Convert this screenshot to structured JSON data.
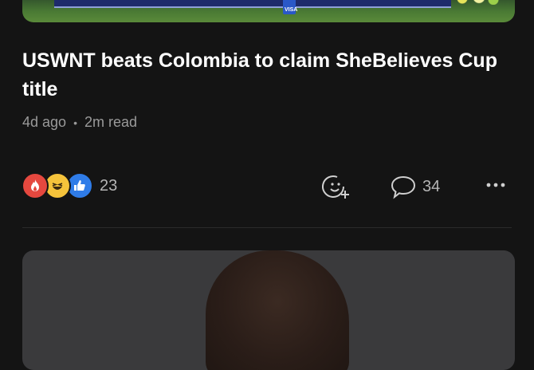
{
  "article": {
    "title": "USWNT beats Colombia to claim SheBelieves Cup title",
    "age": "4d ago",
    "separator": "•",
    "read_time": "2m read",
    "top_image_caption": "VISA"
  },
  "engagement": {
    "reaction_icons": [
      "fire-reaction-icon",
      "laugh-reaction-icon",
      "thumbs-up-reaction-icon"
    ],
    "reaction_count": "23",
    "comment_count": "34"
  },
  "colors": {
    "background": "#141414",
    "secondary_text": "#9a9a9a",
    "fire": "#e5483f",
    "laugh": "#f5c33b",
    "like": "#2f7ce8"
  }
}
